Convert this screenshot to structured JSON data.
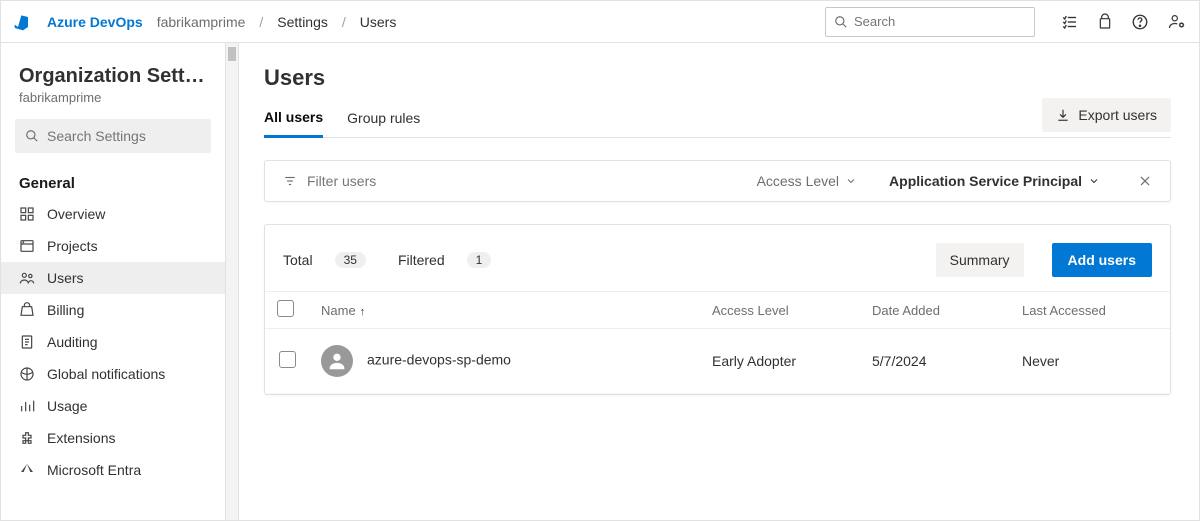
{
  "header": {
    "brand": "Azure DevOps",
    "org": "fabrikamprime",
    "crumb1": "Settings",
    "crumb2": "Users",
    "search_placeholder": "Search"
  },
  "sidebar": {
    "title": "Organization Settin…",
    "subtitle": "fabrikamprime",
    "search_placeholder": "Search Settings",
    "section": "General",
    "items": [
      {
        "label": "Overview"
      },
      {
        "label": "Projects"
      },
      {
        "label": "Users"
      },
      {
        "label": "Billing"
      },
      {
        "label": "Auditing"
      },
      {
        "label": "Global notifications"
      },
      {
        "label": "Usage"
      },
      {
        "label": "Extensions"
      },
      {
        "label": "Microsoft Entra"
      }
    ]
  },
  "page": {
    "title": "Users",
    "tabs": {
      "all": "All users",
      "group": "Group rules"
    },
    "export": "Export users",
    "filter_placeholder": "Filter users",
    "filter_label": "Access Level",
    "filter_value": "Application Service Principal",
    "total_label": "Total",
    "total_count": "35",
    "filtered_label": "Filtered",
    "filtered_count": "1",
    "summary": "Summary",
    "add": "Add users",
    "columns": {
      "name": "Name",
      "access": "Access Level",
      "added": "Date Added",
      "last": "Last Accessed"
    },
    "rows": [
      {
        "name": "azure-devops-sp-demo",
        "access": "Early Adopter",
        "added": "5/7/2024",
        "last": "Never"
      }
    ]
  }
}
